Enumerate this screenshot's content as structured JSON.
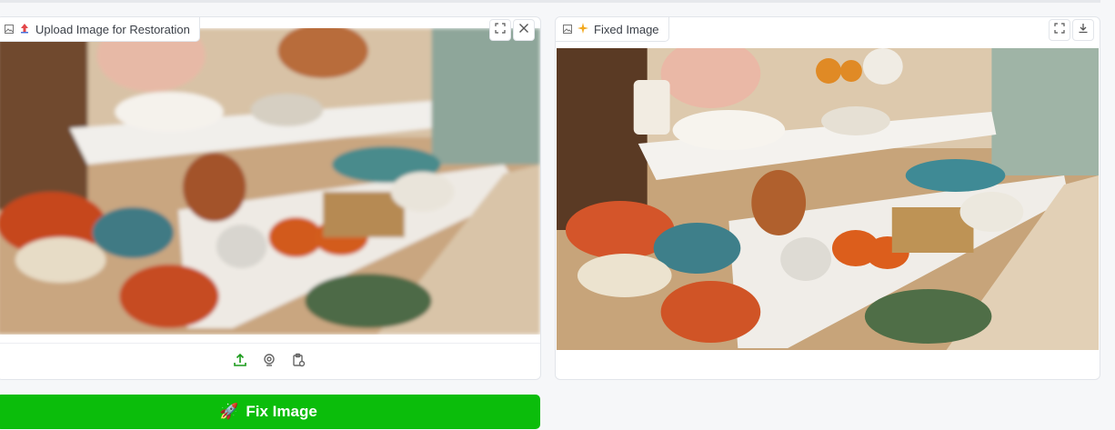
{
  "input_panel": {
    "label": "Upload Image for Restoration",
    "label_icon": "image-icon",
    "buttons": [
      "fullscreen-icon",
      "close-icon"
    ],
    "sources": [
      "upload-icon",
      "webcam-icon",
      "clipboard-icon"
    ]
  },
  "output_panel": {
    "label": "Fixed Image",
    "label_icon": "image-icon",
    "buttons": [
      "fullscreen-icon",
      "download-icon"
    ]
  },
  "action": {
    "fix_label": "Fix Image",
    "fix_icon": "🚀"
  },
  "colors": {
    "accent": "#0bbd0b",
    "source_icons": "#1a9a1a"
  }
}
